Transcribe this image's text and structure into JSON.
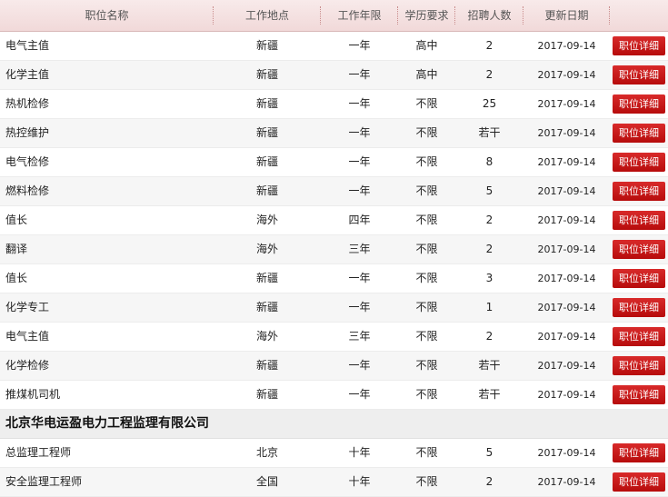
{
  "header": {
    "name": "职位名称",
    "location": "工作地点",
    "years": "工作年限",
    "education": "学历要求",
    "count": "招聘人数",
    "date": "更新日期"
  },
  "detail_label": "职位详细",
  "rows": [
    {
      "name": "电气主值",
      "location": "新疆",
      "years": "一年",
      "education": "高中",
      "count": "2",
      "date": "2017-09-14"
    },
    {
      "name": "化学主值",
      "location": "新疆",
      "years": "一年",
      "education": "高中",
      "count": "2",
      "date": "2017-09-14"
    },
    {
      "name": "热机检修",
      "location": "新疆",
      "years": "一年",
      "education": "不限",
      "count": "25",
      "date": "2017-09-14"
    },
    {
      "name": "热控维护",
      "location": "新疆",
      "years": "一年",
      "education": "不限",
      "count": "若干",
      "date": "2017-09-14"
    },
    {
      "name": "电气检修",
      "location": "新疆",
      "years": "一年",
      "education": "不限",
      "count": "8",
      "date": "2017-09-14"
    },
    {
      "name": "燃料检修",
      "location": "新疆",
      "years": "一年",
      "education": "不限",
      "count": "5",
      "date": "2017-09-14"
    },
    {
      "name": "值长",
      "location": "海外",
      "years": "四年",
      "education": "不限",
      "count": "2",
      "date": "2017-09-14"
    },
    {
      "name": "翻译",
      "location": "海外",
      "years": "三年",
      "education": "不限",
      "count": "2",
      "date": "2017-09-14"
    },
    {
      "name": "值长",
      "location": "新疆",
      "years": "一年",
      "education": "不限",
      "count": "3",
      "date": "2017-09-14"
    },
    {
      "name": "化学专工",
      "location": "新疆",
      "years": "一年",
      "education": "不限",
      "count": "1",
      "date": "2017-09-14"
    },
    {
      "name": "电气主值",
      "location": "海外",
      "years": "三年",
      "education": "不限",
      "count": "2",
      "date": "2017-09-14"
    },
    {
      "name": "化学检修",
      "location": "新疆",
      "years": "一年",
      "education": "不限",
      "count": "若干",
      "date": "2017-09-14"
    },
    {
      "name": "推煤机司机",
      "location": "新疆",
      "years": "一年",
      "education": "不限",
      "count": "若干",
      "date": "2017-09-14"
    }
  ],
  "company2": {
    "title": "北京华电运盈电力工程监理有限公司",
    "rows": [
      {
        "name": "总监理工程师",
        "location": "北京",
        "years": "十年",
        "education": "不限",
        "count": "5",
        "date": "2017-09-14"
      },
      {
        "name": "安全监理工程师",
        "location": "全国",
        "years": "十年",
        "education": "不限",
        "count": "2",
        "date": "2017-09-14"
      }
    ]
  },
  "colors": {
    "button": "#c91313",
    "header_bg": "#f3dede"
  }
}
